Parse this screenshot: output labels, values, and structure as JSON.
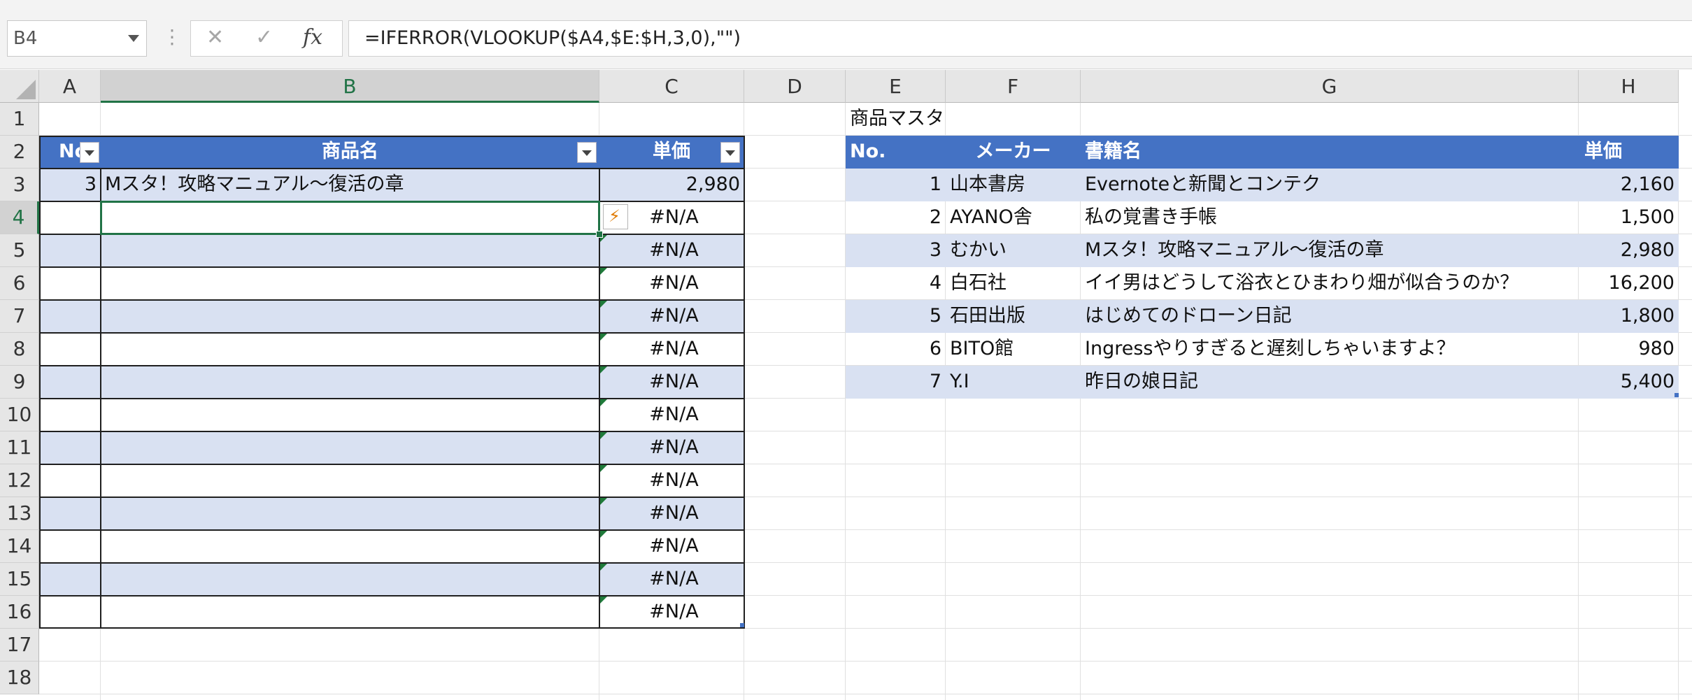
{
  "formula_bar": {
    "name_box": "B4",
    "separator": "⋮",
    "cancel_icon": "✕",
    "enter_icon": "✓",
    "fx_label": "fx",
    "formula": "=IFERROR(VLOOKUP($A4,$E:$H,3,0),\"\")"
  },
  "columns": [
    "A",
    "B",
    "C",
    "D",
    "E",
    "F",
    "G",
    "H"
  ],
  "rows": [
    "1",
    "2",
    "3",
    "4",
    "5",
    "6",
    "7",
    "8",
    "9",
    "10",
    "11",
    "12",
    "13",
    "14",
    "15",
    "16",
    "17",
    "18"
  ],
  "left_table": {
    "headers": [
      "No",
      "商品名",
      "単価"
    ],
    "row3": {
      "no": "3",
      "name": "Mスタ！攻略マニュアル〜復活の章",
      "price": "2,980"
    },
    "error_value": "#N/A"
  },
  "right_table": {
    "title": "商品マスタ",
    "headers": [
      "No.",
      "メーカー",
      "書籍名",
      "単価"
    ],
    "rows": [
      {
        "no": "1",
        "maker": "山本書房",
        "title": "Evernoteと新聞とコンテク",
        "price": "2,160"
      },
      {
        "no": "2",
        "maker": "AYANO舎",
        "title": "私の覚書き手帳",
        "price": "1,500"
      },
      {
        "no": "3",
        "maker": "むかい",
        "title": "Mスタ！攻略マニュアル〜復活の章",
        "price": "2,980"
      },
      {
        "no": "4",
        "maker": "白石社",
        "title": "イイ男はどうして浴衣とひまわり畑が似合うのか？",
        "price": "16,200"
      },
      {
        "no": "5",
        "maker": "石田出版",
        "title": "はじめてのドローン日記",
        "price": "1,800"
      },
      {
        "no": "6",
        "maker": "BITO館",
        "title": "Ingressやりすぎると遅刻しちゃいますよ？",
        "price": "980"
      },
      {
        "no": "7",
        "maker": "Y.I",
        "title": "昨日の娘日記",
        "price": "5,400"
      }
    ]
  },
  "colors": {
    "table_header": "#4472c4",
    "band": "#d9e1f2",
    "selection": "#217346"
  }
}
